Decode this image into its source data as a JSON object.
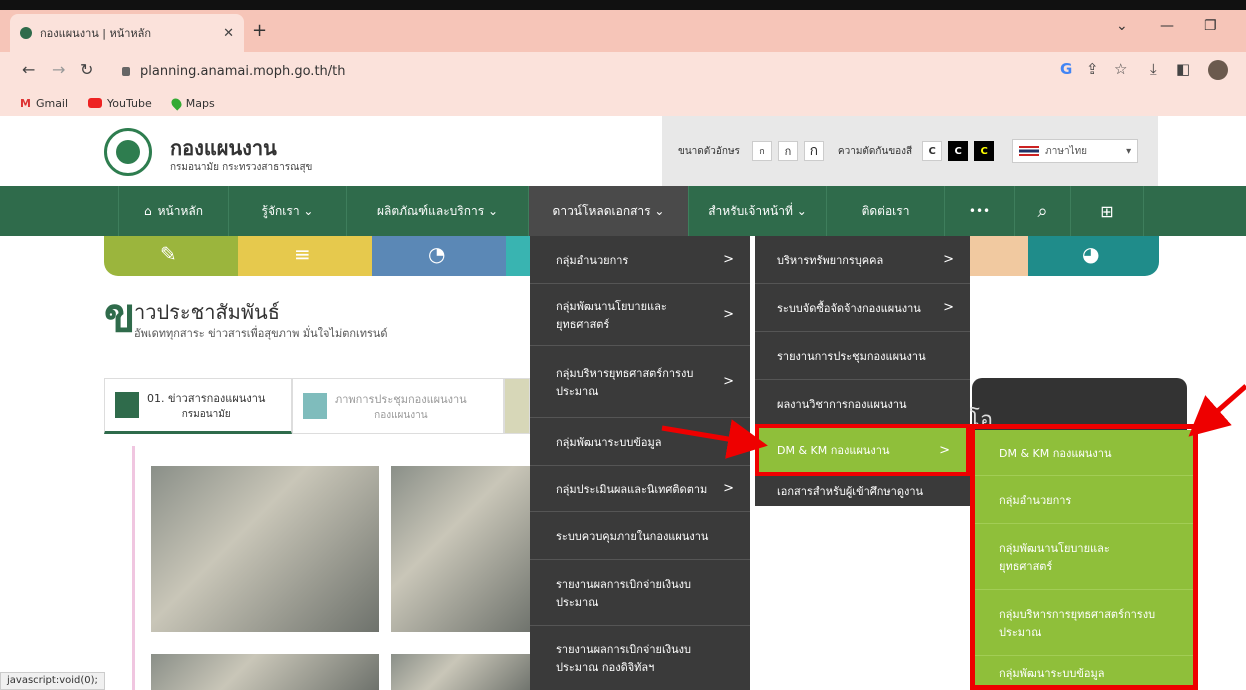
{
  "browser": {
    "tab_title": "กองแผนงาน | หน้าหลัก",
    "new_tab": "+",
    "url": "planning.anamai.moph.go.th/th",
    "status": "javascript:void(0);"
  },
  "bookmarks": [
    {
      "label": "Gmail"
    },
    {
      "label": "YouTube"
    },
    {
      "label": "Maps"
    }
  ],
  "site": {
    "title": "กองแผนงาน",
    "subtitle": "กรมอนามัย กระทรวงสาธารณสุข"
  },
  "access": {
    "font_label": "ขนาดตัวอักษร",
    "font_sizes": [
      "ก",
      "ก",
      "ก"
    ],
    "contrast_label": "ความตัดกันของสี",
    "contrast": [
      "C",
      "C",
      "C"
    ],
    "language": "ภาษาไทย"
  },
  "nav": {
    "home": "หน้าหลัก",
    "about": "รู้จักเรา ⌄",
    "products": "ผลิตภัณฑ์และบริการ ⌄",
    "downloads": "ดาวน์โหลดเอกสาร ⌄",
    "staff": "สำหรับเจ้าหน้าที่ ⌄",
    "contact": "ติดต่อเรา",
    "more": "•••"
  },
  "news": {
    "icon": "ข",
    "title": "าวประชาสัมพันธ์",
    "subtitle": "อัพเดททุกสาระ ข่าวสารเพื่อสุขภาพ มั่นใจไม่ตกเทรนด์",
    "tab1": "01. ข่าวสารกองแผนงาน",
    "tab1_sub": "กรมอนามัย",
    "tab2": "ภาพการประชุมกองแผนงาน",
    "tab2_sub": "กองแผนงาน",
    "video_label": "โอ"
  },
  "menu1": [
    {
      "label": "กลุ่มอำนวยการ",
      "arrow": ">"
    },
    {
      "label": "กลุ่มพัฒนานโยบายและยุทธศาสตร์",
      "arrow": ">"
    },
    {
      "label": "กลุ่มบริหารยุทธศาสตร์การงบประมาณ",
      "arrow": ">"
    },
    {
      "label": "กลุ่มพัฒนาระบบข้อมูล",
      "arrow": ""
    },
    {
      "label": "กลุ่มประเมินผลและนิเทศติดตาม",
      "arrow": ">"
    },
    {
      "label": "ระบบควบคุมภายในกองแผนงาน",
      "arrow": ""
    },
    {
      "label": "รายงานผลการเบิกจ่ายเงินงบประมาณ",
      "arrow": ""
    },
    {
      "label": "รายงานผลการเบิกจ่ายเงินงบประมาณ กองดิจิทัลฯ",
      "arrow": ""
    }
  ],
  "menu2": [
    {
      "label": "บริหารทรัพยากรบุคคล",
      "arrow": ">"
    },
    {
      "label": "ระบบจัดซื้อจัดจ้างกองแผนงาน",
      "arrow": ">"
    },
    {
      "label": "รายงานการประชุมกองแผนงาน",
      "arrow": ""
    },
    {
      "label": "ผลงานวิชาการกองแผนงาน",
      "arrow": ""
    },
    {
      "label": "DM & KM กองแผนงาน",
      "arrow": ">"
    },
    {
      "label": "เอกสารสำหรับผู้เข้าศึกษาดูงาน",
      "arrow": ""
    }
  ],
  "menu3": [
    {
      "label": "DM & KM กองแผนงาน"
    },
    {
      "label": "กลุ่มอำนวยการ"
    },
    {
      "label": "กลุ่มพัฒนานโยบายและยุทธศาสตร์"
    },
    {
      "label": "กลุ่มบริหารการยุทธศาสตร์การงบประมาณ"
    },
    {
      "label": "กลุ่มพัฒนาระบบข้อมูล"
    }
  ],
  "colors": {
    "nav_green": "#2f6b4b",
    "menu_dark": "#3a3a3a",
    "submenu_green": "#8fbf3a",
    "annotation_red": "#e00000"
  }
}
